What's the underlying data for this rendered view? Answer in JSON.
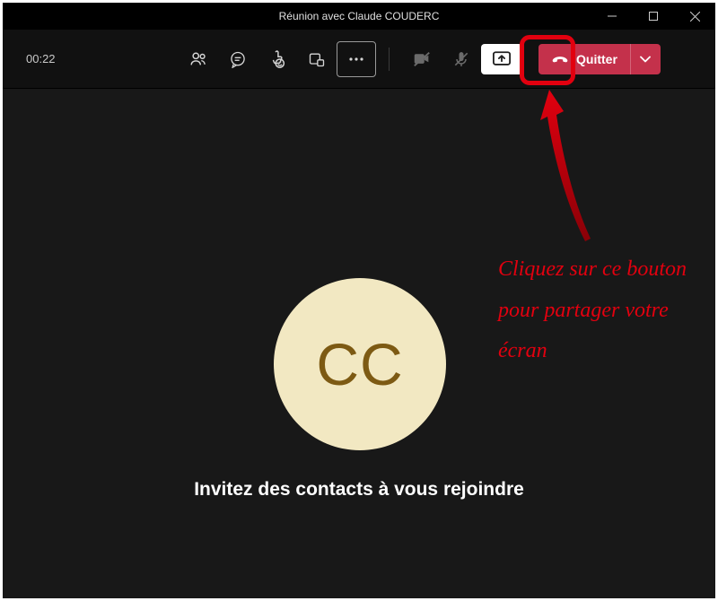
{
  "titlebar": {
    "title": "Réunion avec Claude COUDERC"
  },
  "toolbar": {
    "timer": "00:22",
    "leave_label": "Quitter"
  },
  "avatar": {
    "initials": "CC"
  },
  "stage": {
    "invite_text": "Invitez des contacts à vous rejoindre"
  },
  "annotation": {
    "text": "Cliquez sur ce bouton pour partager votre écran"
  }
}
